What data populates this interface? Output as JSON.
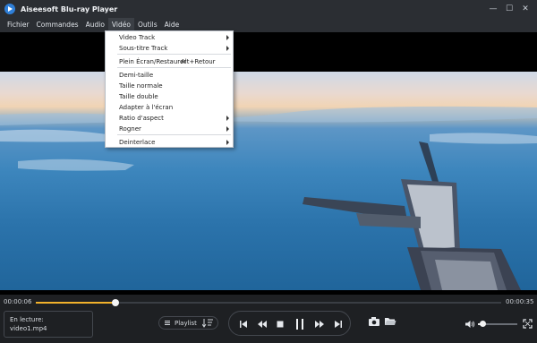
{
  "app": {
    "title": "Aiseesoft Blu-ray Player"
  },
  "window_controls": {
    "minimize": "—",
    "maximize": "☐",
    "close": "✕"
  },
  "menubar": {
    "items": [
      {
        "label": "Fichier"
      },
      {
        "label": "Commandes"
      },
      {
        "label": "Audio"
      },
      {
        "label": "Vidéo",
        "active": true
      },
      {
        "label": "Outils"
      },
      {
        "label": "Aide"
      }
    ]
  },
  "video_menu": {
    "items": [
      {
        "label": "Video Track",
        "submenu": true
      },
      {
        "label": "Sous-titre Track",
        "submenu": true
      },
      {
        "label": "Plein Écran/Restaurer",
        "shortcut": "Alt+Retour"
      },
      {
        "label": "Demi-taille"
      },
      {
        "label": "Taille normale"
      },
      {
        "label": "Taille double"
      },
      {
        "label": "Adapter à l'écran"
      },
      {
        "label": "Ratio d'aspect",
        "submenu": true
      },
      {
        "label": "Rogner",
        "submenu": true
      },
      {
        "label": "Deinterlace",
        "submenu": true
      }
    ]
  },
  "playback": {
    "current_time": "00:00:06",
    "total_time": "00:00:35",
    "progress_fraction": 0.171,
    "volume_fraction": 0.12
  },
  "now_playing": {
    "label": "En lecture:",
    "filename": "video1.mp4"
  },
  "playlist_button": {
    "label": "Playlist"
  },
  "colors": {
    "accent": "#f1b12c",
    "background": "#1e2023",
    "menubar": "#2b2e33"
  },
  "icons": [
    "play-logo-icon",
    "skip-previous-icon",
    "rewind-icon",
    "stop-icon",
    "pause-icon",
    "fast-forward-icon",
    "skip-next-icon",
    "snapshot-camera-icon",
    "open-folder-icon",
    "volume-icon",
    "fullscreen-icon",
    "playlist-icon",
    "sort-icon"
  ]
}
